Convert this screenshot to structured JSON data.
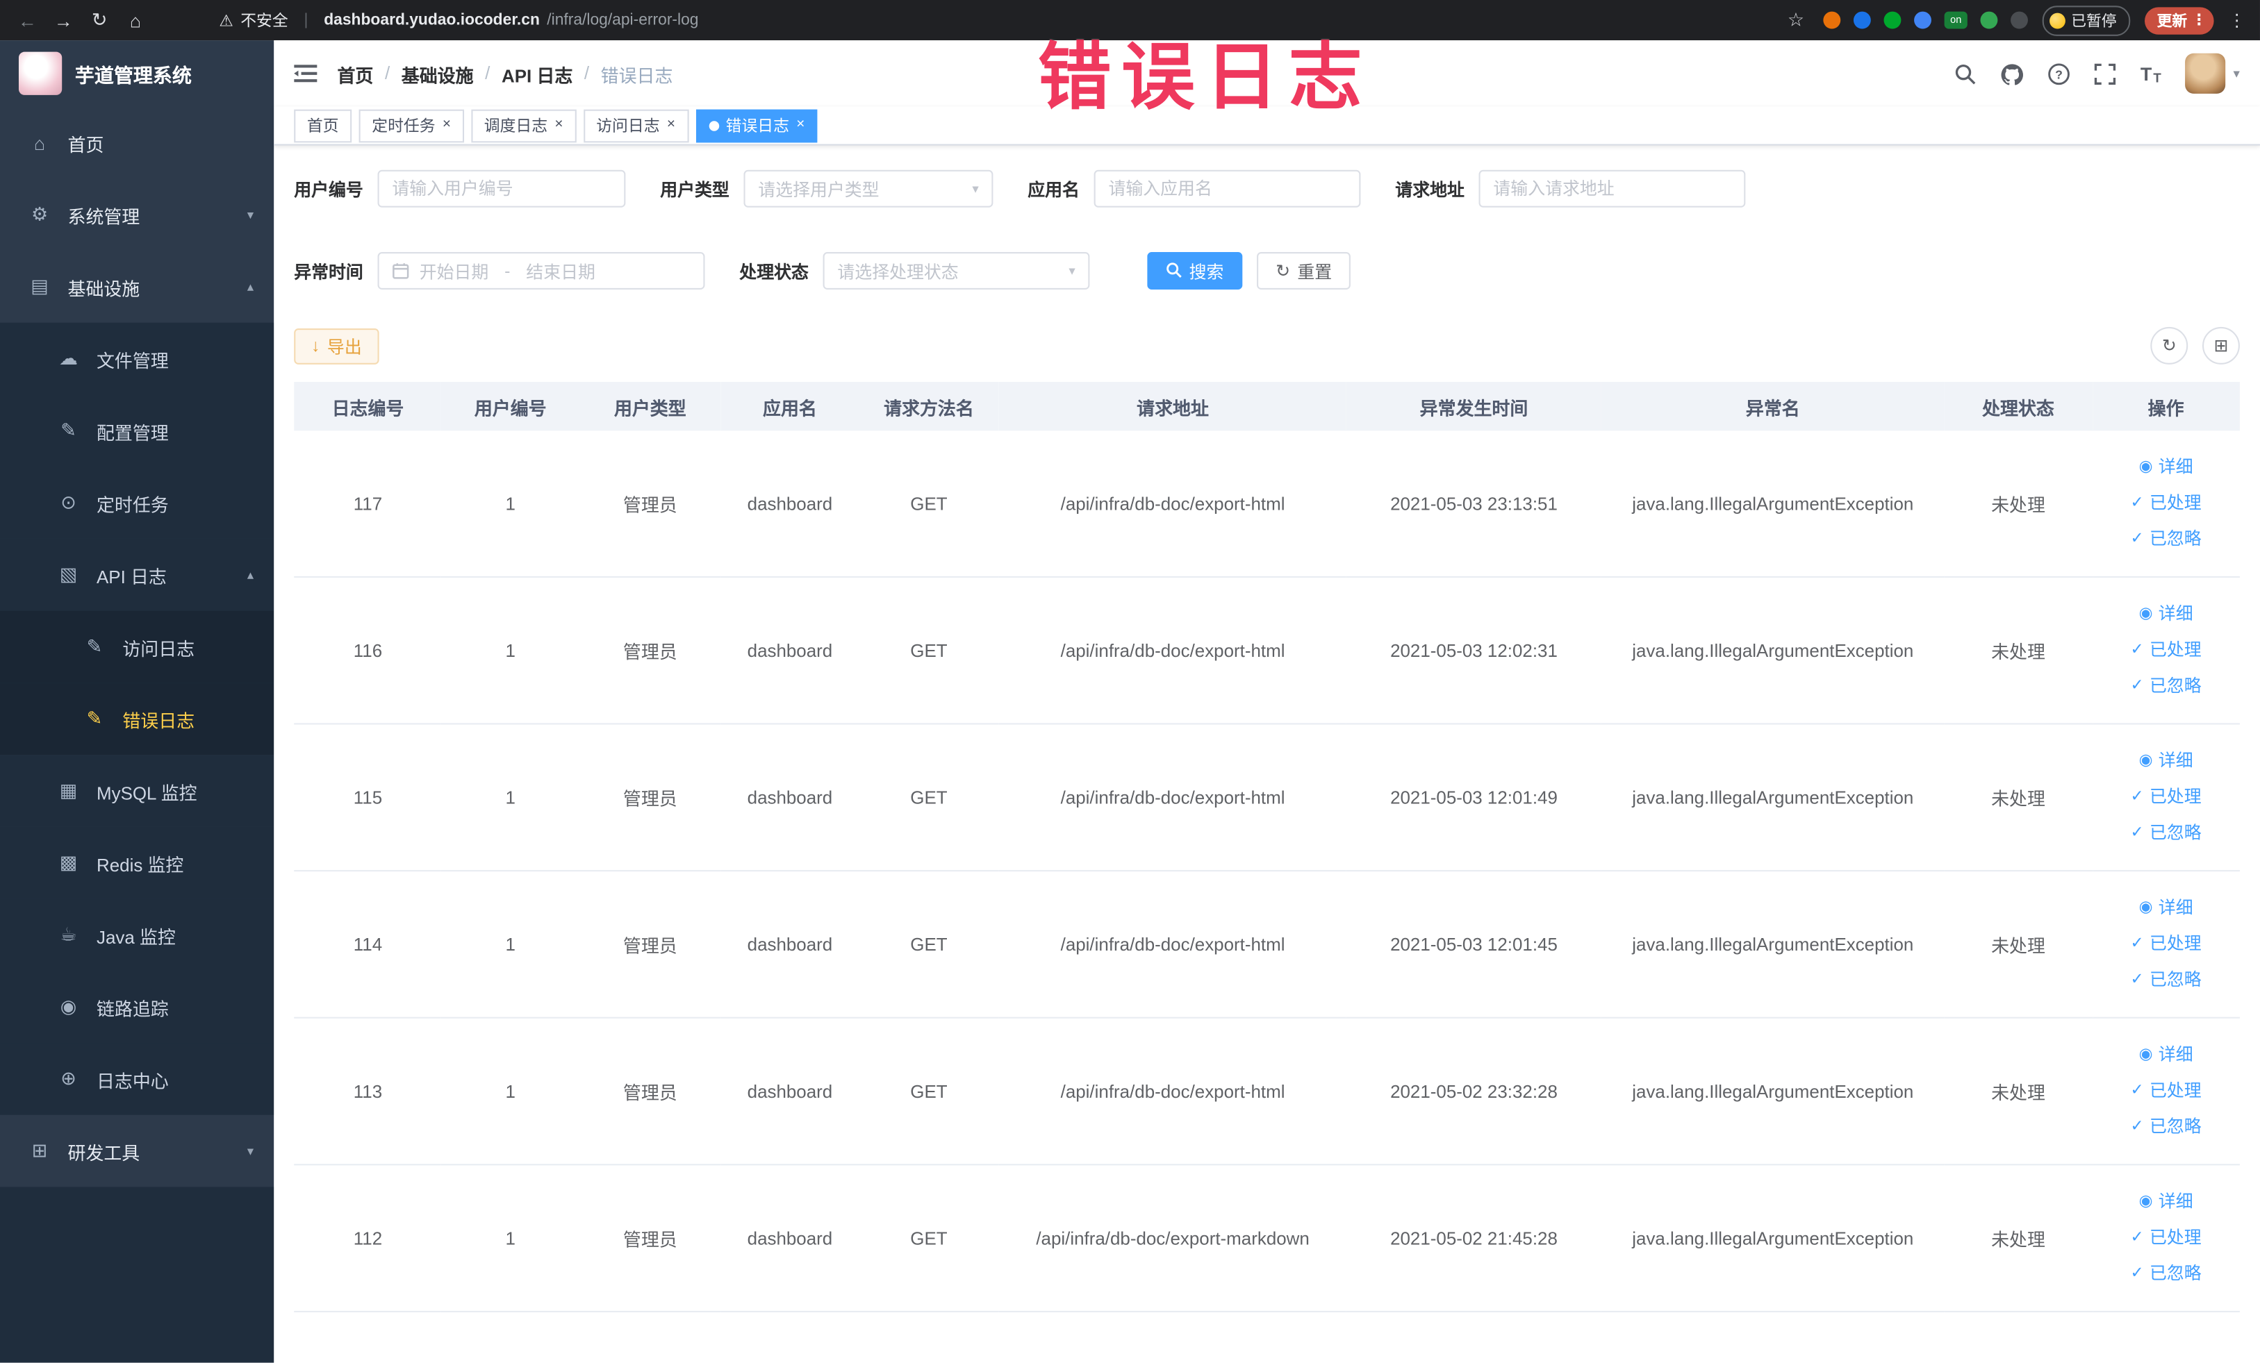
{
  "colors": {
    "accent": "#409eff",
    "warning": "#e6a23c",
    "sidebar_bg": "#2d3a4b",
    "submenu_bg": "#1f2d3d",
    "active_menu_text": "#ffd04b",
    "annotation": "#ee2b52",
    "table_header_bg": "#f0f3f8"
  },
  "browser": {
    "security_label": "不安全",
    "url_domain": "dashboard.yudao.iocoder.cn",
    "url_path": "/infra/log/api-error-log",
    "paused_label": "已暂停",
    "update_label": "更新",
    "ext_icons": [
      {
        "name": "extension-icon-orange",
        "color": "#e8710a"
      },
      {
        "name": "extension-icon-blue-drop",
        "color": "#1a73e8"
      },
      {
        "name": "extension-icon-green-circle",
        "color": "#00a82d"
      },
      {
        "name": "extension-icon-blue-grid",
        "color": "#4285f4"
      },
      {
        "name": "extension-icon-on-badge",
        "color": "#188038",
        "text": "on"
      },
      {
        "name": "extension-icon-leaf",
        "color": "#34a853"
      },
      {
        "name": "extension-icon-paw",
        "color": "#4a4d51"
      }
    ]
  },
  "sidebar": {
    "logo_title": "芋道管理系统",
    "items": [
      {
        "key": "home",
        "label": "首页",
        "depth": 0,
        "icon": "dashboard-icon"
      },
      {
        "key": "system",
        "label": "系统管理",
        "depth": 0,
        "icon": "gear-icon",
        "chevron": "down"
      },
      {
        "key": "infra",
        "label": "基础设施",
        "depth": 0,
        "icon": "infrastructure-icon",
        "chevron": "up"
      },
      {
        "key": "file",
        "label": "文件管理",
        "depth": 1,
        "icon": "file-icon"
      },
      {
        "key": "config",
        "label": "配置管理",
        "depth": 1,
        "icon": "config-icon"
      },
      {
        "key": "task",
        "label": "定时任务",
        "depth": 1,
        "icon": "task-icon"
      },
      {
        "key": "api-log",
        "label": "API 日志",
        "depth": 1,
        "icon": "api-log-icon",
        "chevron": "up"
      },
      {
        "key": "access-log",
        "label": "访问日志",
        "depth": 2,
        "icon": "access-log-icon"
      },
      {
        "key": "error-log",
        "label": "错误日志",
        "depth": 2,
        "icon": "error-log-icon",
        "active": true
      },
      {
        "key": "mysql",
        "label": "MySQL 监控",
        "depth": 1,
        "icon": "mysql-icon"
      },
      {
        "key": "redis",
        "label": "Redis 监控",
        "depth": 1,
        "icon": "redis-icon"
      },
      {
        "key": "java",
        "label": "Java 监控",
        "depth": 1,
        "icon": "java-icon"
      },
      {
        "key": "trace",
        "label": "链路追踪",
        "depth": 1,
        "icon": "trace-icon"
      },
      {
        "key": "log-center",
        "label": "日志中心",
        "depth": 1,
        "icon": "log-center-icon"
      },
      {
        "key": "devtools",
        "label": "研发工具",
        "depth": 0,
        "icon": "tools-icon",
        "chevron": "down"
      }
    ]
  },
  "header": {
    "breadcrumb": [
      "首页",
      "基础设施",
      "API 日志",
      "错误日志"
    ]
  },
  "tabs": [
    {
      "label": "首页",
      "closable": false,
      "active": false
    },
    {
      "label": "定时任务",
      "closable": true,
      "active": false
    },
    {
      "label": "调度日志",
      "closable": true,
      "active": false
    },
    {
      "label": "访问日志",
      "closable": true,
      "active": false
    },
    {
      "label": "错误日志",
      "closable": true,
      "active": true
    }
  ],
  "filters": {
    "user_id": {
      "label": "用户编号",
      "placeholder": "请输入用户编号",
      "value": ""
    },
    "user_type": {
      "label": "用户类型",
      "placeholder": "请选择用户类型"
    },
    "app_name": {
      "label": "应用名",
      "placeholder": "请输入应用名",
      "value": ""
    },
    "request_url": {
      "label": "请求地址",
      "placeholder": "请输入请求地址",
      "value": ""
    },
    "exception_time": {
      "label": "异常时间",
      "start_placeholder": "开始日期",
      "separator": "-",
      "end_placeholder": "结束日期"
    },
    "status": {
      "label": "处理状态",
      "placeholder": "请选择处理状态"
    },
    "search_label": "搜索",
    "reset_label": "重置"
  },
  "toolbar": {
    "export_label": "导出"
  },
  "table": {
    "headers": [
      "日志编号",
      "用户编号",
      "用户类型",
      "应用名",
      "请求方法名",
      "请求地址",
      "异常发生时间",
      "异常名",
      "处理状态",
      "操作"
    ],
    "row_actions": [
      {
        "label": "详细",
        "icon": "eye-icon"
      },
      {
        "label": "已处理",
        "icon": "check-icon"
      },
      {
        "label": "已忽略",
        "icon": "check-icon"
      }
    ],
    "rows": [
      {
        "id": "117",
        "user_id": "1",
        "user_type": "管理员",
        "app_name": "dashboard",
        "method": "GET",
        "url": "/api/infra/db-doc/export-html",
        "time": "2021-05-03 23:13:51",
        "exception": "java.lang.IllegalArgumentException",
        "status": "未处理"
      },
      {
        "id": "116",
        "user_id": "1",
        "user_type": "管理员",
        "app_name": "dashboard",
        "method": "GET",
        "url": "/api/infra/db-doc/export-html",
        "time": "2021-05-03 12:02:31",
        "exception": "java.lang.IllegalArgumentException",
        "status": "未处理"
      },
      {
        "id": "115",
        "user_id": "1",
        "user_type": "管理员",
        "app_name": "dashboard",
        "method": "GET",
        "url": "/api/infra/db-doc/export-html",
        "time": "2021-05-03 12:01:49",
        "exception": "java.lang.IllegalArgumentException",
        "status": "未处理"
      },
      {
        "id": "114",
        "user_id": "1",
        "user_type": "管理员",
        "app_name": "dashboard",
        "method": "GET",
        "url": "/api/infra/db-doc/export-html",
        "time": "2021-05-03 12:01:45",
        "exception": "java.lang.IllegalArgumentException",
        "status": "未处理"
      },
      {
        "id": "113",
        "user_id": "1",
        "user_type": "管理员",
        "app_name": "dashboard",
        "method": "GET",
        "url": "/api/infra/db-doc/export-html",
        "time": "2021-05-02 23:32:28",
        "exception": "java.lang.IllegalArgumentException",
        "status": "未处理"
      },
      {
        "id": "112",
        "user_id": "1",
        "user_type": "管理员",
        "app_name": "dashboard",
        "method": "GET",
        "url": "/api/infra/db-doc/export-markdown",
        "time": "2021-05-02 21:45:28",
        "exception": "java.lang.IllegalArgumentException",
        "status": "未处理"
      }
    ]
  },
  "annotation": {
    "text": "错误日志"
  },
  "icon_glyphs": {
    "dashboard-icon": "⌂",
    "gear-icon": "⚙",
    "infrastructure-icon": "▤",
    "file-icon": "☁",
    "config-icon": "✎",
    "task-icon": "⊙",
    "api-log-icon": "▧",
    "access-log-icon": "✎",
    "error-log-icon": "✎",
    "mysql-icon": "▦",
    "redis-icon": "▩",
    "java-icon": "☕",
    "trace-icon": "◉",
    "log-center-icon": "⊕",
    "tools-icon": "⊞",
    "eye-icon": "◉",
    "check-icon": "✓",
    "refresh-icon": "↻",
    "columns-icon": "⊞",
    "download-icon": "↓",
    "chevron-up": "▴",
    "chevron-down": "▾"
  }
}
